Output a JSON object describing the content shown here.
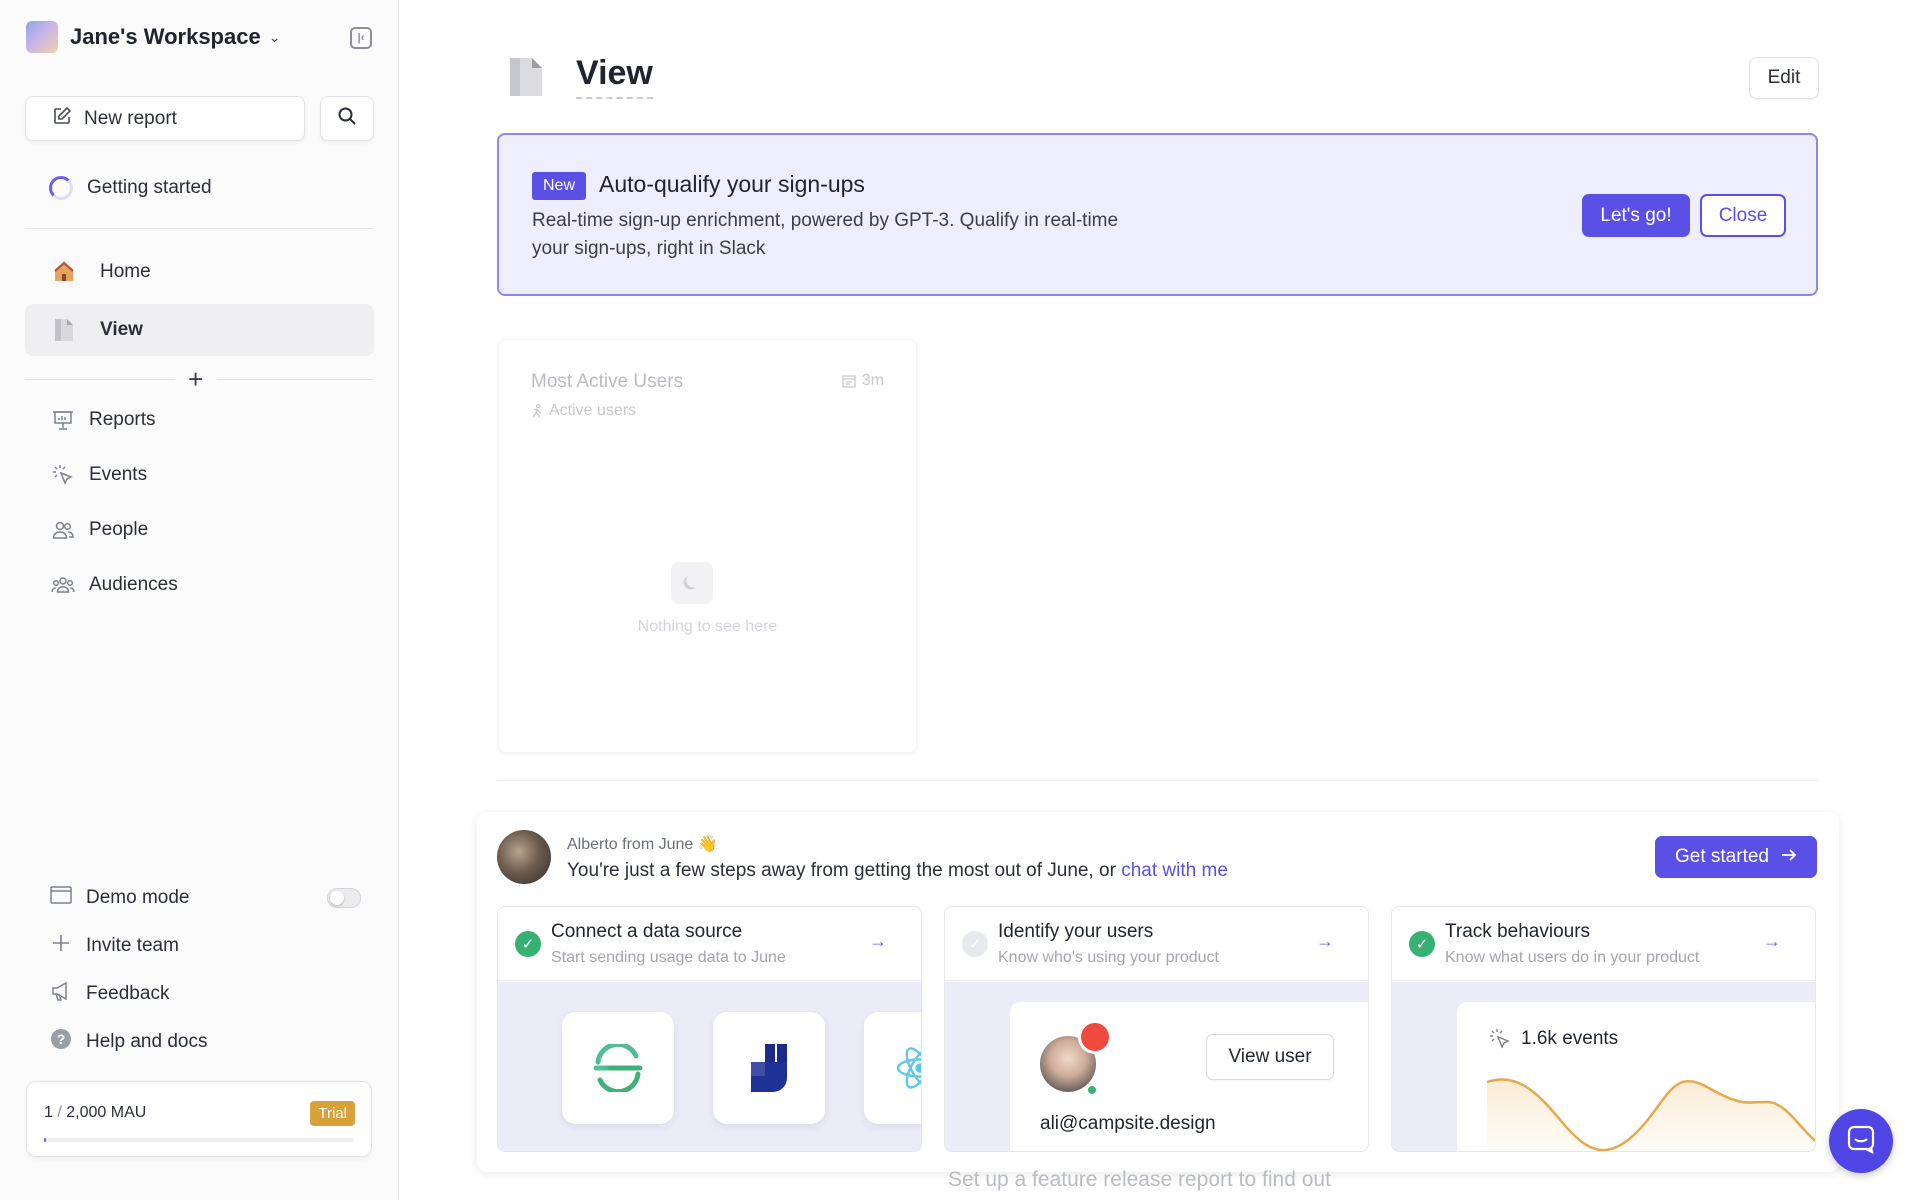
{
  "workspace": {
    "name": "Jane's Workspace"
  },
  "sidebar": {
    "new_report": "New report",
    "getting_started": "Getting started",
    "nav": [
      {
        "label": "Home",
        "icon": "house-icon"
      },
      {
        "label": "View",
        "icon": "page-icon",
        "active": true
      }
    ],
    "sections": [
      {
        "label": "Reports",
        "icon": "presentation-icon"
      },
      {
        "label": "Events",
        "icon": "cursor-click-icon"
      },
      {
        "label": "People",
        "icon": "users-icon"
      },
      {
        "label": "Audiences",
        "icon": "group-icon"
      }
    ],
    "bottom": {
      "demo_mode": "Demo mode",
      "invite_team": "Invite team",
      "feedback": "Feedback",
      "help": "Help and docs"
    },
    "mau": {
      "used": "1",
      "sep": "/",
      "limit": "2,000 MAU",
      "badge": "Trial",
      "progress": 0.0005
    }
  },
  "page": {
    "title": "View",
    "edit_label": "Edit"
  },
  "banner": {
    "badge": "New",
    "title": "Auto-qualify your sign-ups",
    "desc_line1": "Real-time sign-up enrichment, powered by GPT-3. Qualify in real-time",
    "desc_line2": "your sign-ups, right in Slack",
    "primary": "Let's go!",
    "secondary": "Close"
  },
  "widget": {
    "title": "Most Active Users",
    "subtitle": "Active users",
    "time": "3m",
    "empty": "Nothing to see here"
  },
  "onboarding": {
    "from": "Alberto from June 👋",
    "message": "You're just a few steps away from getting the most out of June, or",
    "link": "chat with me",
    "cta": "Get started",
    "steps": [
      {
        "title": "Connect a data source",
        "sub": "Start sending usage data to June",
        "done": true
      },
      {
        "title": "Identify your users",
        "sub": "Know who's using your product",
        "done": false
      },
      {
        "title": "Track behaviours",
        "sub": "Know what users do in your product",
        "done": true
      }
    ],
    "user_card": {
      "button": "View user",
      "email": "ali@campsite.design"
    },
    "events_card": {
      "label": "1.6k events"
    }
  },
  "footer": {
    "text": "Set up a feature release report to find out"
  },
  "colors": {
    "accent": "#5b50e6",
    "success": "#37b073",
    "trial": "#d8a13a",
    "banner_bg": "#efeefe"
  }
}
